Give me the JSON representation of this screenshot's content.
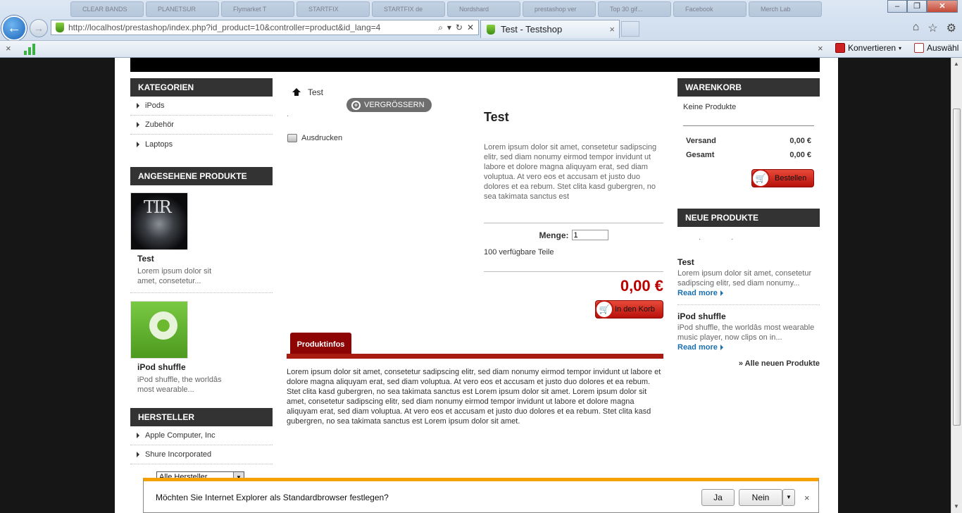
{
  "browser": {
    "url": "http://localhost/prestashop/index.php?id_product=10&controller=product&id_lang=4",
    "tab_title": "Test - Testshop",
    "tab_close": "×",
    "toolbar_close": "×",
    "convert_label": "Konvertieren",
    "select_label": "Auswähl",
    "taskstrip": [
      "CLEAR BANDS",
      "PLANETSUR",
      "Flymarket T",
      "STARTFIX",
      "STARTFIX de",
      "Nordshard",
      "prestashop ver",
      "Top 30 gif...",
      "Facebook",
      "Merch Lab"
    ]
  },
  "left": {
    "categories_title": "Kategorien",
    "categories": [
      "iPods",
      "Zubehör",
      "Laptops"
    ],
    "viewed_title": "Angesehene Produkte",
    "viewed": [
      {
        "name": "Test",
        "desc": "Lorem ipsum dolor sit amet, consetetur..."
      },
      {
        "name": "iPod shuffle",
        "desc": "iPod shuffle, the worldâs most wearable..."
      }
    ],
    "manufacturers_title": "Hersteller",
    "manufacturers": [
      "Apple Computer, Inc",
      "Shure Incorporated"
    ],
    "manufacturer_select": "Alle Hersteller"
  },
  "product": {
    "breadcrumb": "Test",
    "zoom_label": "Vergrößern",
    "image_placeholder": "·",
    "print_label": "Ausdrucken",
    "title": "Test",
    "short_desc": "Lorem ipsum dolor sit amet, consetetur sadipscing elitr, sed diam nonumy eirmod tempor invidunt ut labore et dolore magna aliquyam erat, sed diam voluptua. At vero eos et accusam et justo duo dolores et ea rebum. Stet clita kasd gubergren, no sea takimata sanctus est",
    "qty_label": "Menge:",
    "qty_value": "1",
    "stock": "100 verfügbare Teile",
    "price": "0,00 €",
    "add_to_cart": "In den Korb",
    "tab_label": "Produktinfos",
    "long_desc": "Lorem ipsum dolor sit amet, consetetur sadipscing elitr, sed diam nonumy eirmod tempor invidunt ut labore et dolore magna aliquyam erat, sed diam voluptua. At vero eos et accusam et justo duo dolores et ea rebum. Stet clita kasd gubergren, no sea takimata sanctus est Lorem ipsum dolor sit amet. Lorem ipsum dolor sit amet, consetetur sadipscing elitr, sed diam nonumy eirmod tempor invidunt ut labore et dolore magna aliquyam erat, sed diam voluptua. At vero eos et accusam et justo duo dolores et ea rebum. Stet clita kasd gubergren, no sea takimata sanctus est Lorem ipsum dolor sit amet."
  },
  "cart": {
    "title": "Warenkorb",
    "empty": "Keine Produkte",
    "shipping_label": "Versand",
    "shipping_value": "0,00 €",
    "total_label": "Gesamt",
    "total_value": "0,00 €",
    "checkout": "Bestellen"
  },
  "new_products": {
    "title": "Neue Produkte",
    "dots": "· ·",
    "items": [
      {
        "name": "Test",
        "desc": "Lorem ipsum dolor sit amet, consetetur sadipscing elitr, sed diam nonumy...",
        "more": "Read more"
      },
      {
        "name": "iPod shuffle",
        "desc": "iPod shuffle, the worldâs most wearable music player, now clips on in...",
        "more": "Read more"
      }
    ],
    "all_link": "» Alle neuen Produkte"
  },
  "notification": {
    "text": "Möchten Sie Internet Explorer als Standardbrowser festlegen?",
    "yes": "Ja",
    "no": "Nein",
    "close": "×"
  },
  "colors": {
    "accent_red": "#b8100a",
    "header_dark": "#333333",
    "notify_orange": "#f5a200",
    "link_blue": "#1a6fae"
  }
}
